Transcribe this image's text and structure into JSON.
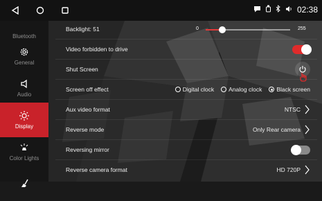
{
  "status": {
    "time": "02:38",
    "icons": [
      "back-triangle-icon",
      "home-circle-icon",
      "recent-square-icon",
      "chat-bubble-icon",
      "usb-icon",
      "bluetooth-icon",
      "volume-icon"
    ]
  },
  "sidebar": {
    "items": [
      {
        "label": "Bluetooth",
        "icon": "bluetooth-icon"
      },
      {
        "label": "General",
        "icon": "gear-icon"
      },
      {
        "label": "Audio",
        "icon": "speaker-icon"
      },
      {
        "label": "Display",
        "icon": "sun-icon",
        "active": true
      },
      {
        "label": "Color Lights",
        "icon": "light-icon"
      },
      {
        "label": "",
        "icon": "broom-icon"
      }
    ]
  },
  "settings": {
    "backlight": {
      "label": "Backlight: 51",
      "min": "0",
      "max": "255",
      "value": 51,
      "range": 255
    },
    "video_forbidden": {
      "label": "Video forbidden to drive",
      "on": true
    },
    "shut_screen": {
      "label": "Shut Screen"
    },
    "screen_off_effect": {
      "label": "Screen off effect",
      "options": [
        "Digital clock",
        "Analog clock",
        "Black screen"
      ],
      "selected": "Black screen"
    },
    "aux_video_format": {
      "label": "Aux video format",
      "value": "NTSC"
    },
    "reverse_mode": {
      "label": "Reverse mode",
      "value": "Only Rear camera"
    },
    "reversing_mirror": {
      "label": "Reversing mirror",
      "on": false
    },
    "reverse_camera_format": {
      "label": "Reverse camera format",
      "value": "HD 720P"
    }
  },
  "colors": {
    "accent": "#e02b2b",
    "sidebar_active": "#c9222a"
  }
}
